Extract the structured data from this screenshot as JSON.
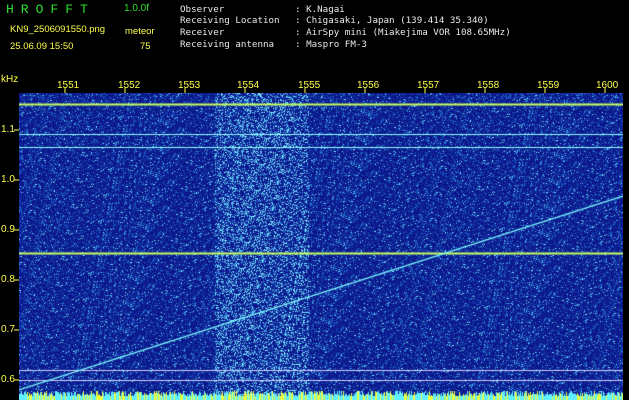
{
  "header": {
    "app_title": "HROFFT",
    "version": "1.0.0f",
    "filename": "KN9_2506091550.png",
    "meteor_label": "meteor",
    "datetime": "25.06.09 15:50",
    "meteor_count": "75"
  },
  "info": [
    {
      "label": "Observer",
      "value": ": K.Nagai"
    },
    {
      "label": "Receiving Location",
      "value": ": Chigasaki, Japan (139.414 35.340)"
    },
    {
      "label": "Receiver",
      "value": ": AirSpy mini (Miakejima VOR 108.65MHz)"
    },
    {
      "label": "Receiving antenna",
      "value": ": Maspro FM-3"
    }
  ],
  "axes": {
    "y_unit": "kHz",
    "y_ticks": [
      "1.1",
      "1.0",
      "0.9",
      "0.8",
      "0.7",
      "0.6"
    ],
    "x_ticks": [
      "1551",
      "1552",
      "1553",
      "1554",
      "1555",
      "1556",
      "1557",
      "1558",
      "1559",
      "1600"
    ]
  },
  "colors": {
    "background": "#000000",
    "plot_bg": "#0c1890",
    "title": "#2ee02e",
    "label": "#ffff4a",
    "info_text": "#e8e8e8",
    "signal": "#7fffff"
  }
}
